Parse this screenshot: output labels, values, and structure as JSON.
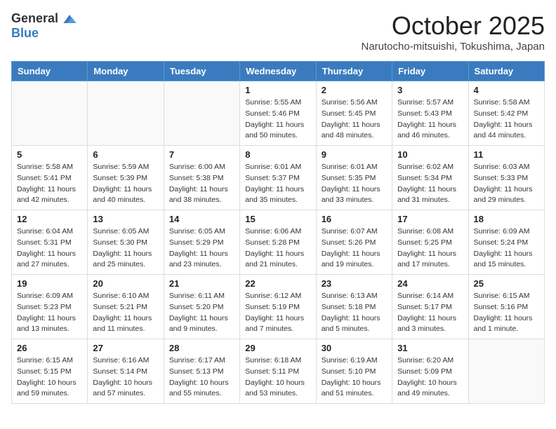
{
  "logo": {
    "general": "General",
    "blue": "Blue"
  },
  "title": "October 2025",
  "location": "Narutocho-mitsuishi, Tokushima, Japan",
  "weekdays": [
    "Sunday",
    "Monday",
    "Tuesday",
    "Wednesday",
    "Thursday",
    "Friday",
    "Saturday"
  ],
  "weeks": [
    [
      {
        "day": "",
        "info": ""
      },
      {
        "day": "",
        "info": ""
      },
      {
        "day": "",
        "info": ""
      },
      {
        "day": "1",
        "info": "Sunrise: 5:55 AM\nSunset: 5:46 PM\nDaylight: 11 hours\nand 50 minutes."
      },
      {
        "day": "2",
        "info": "Sunrise: 5:56 AM\nSunset: 5:45 PM\nDaylight: 11 hours\nand 48 minutes."
      },
      {
        "day": "3",
        "info": "Sunrise: 5:57 AM\nSunset: 5:43 PM\nDaylight: 11 hours\nand 46 minutes."
      },
      {
        "day": "4",
        "info": "Sunrise: 5:58 AM\nSunset: 5:42 PM\nDaylight: 11 hours\nand 44 minutes."
      }
    ],
    [
      {
        "day": "5",
        "info": "Sunrise: 5:58 AM\nSunset: 5:41 PM\nDaylight: 11 hours\nand 42 minutes."
      },
      {
        "day": "6",
        "info": "Sunrise: 5:59 AM\nSunset: 5:39 PM\nDaylight: 11 hours\nand 40 minutes."
      },
      {
        "day": "7",
        "info": "Sunrise: 6:00 AM\nSunset: 5:38 PM\nDaylight: 11 hours\nand 38 minutes."
      },
      {
        "day": "8",
        "info": "Sunrise: 6:01 AM\nSunset: 5:37 PM\nDaylight: 11 hours\nand 35 minutes."
      },
      {
        "day": "9",
        "info": "Sunrise: 6:01 AM\nSunset: 5:35 PM\nDaylight: 11 hours\nand 33 minutes."
      },
      {
        "day": "10",
        "info": "Sunrise: 6:02 AM\nSunset: 5:34 PM\nDaylight: 11 hours\nand 31 minutes."
      },
      {
        "day": "11",
        "info": "Sunrise: 6:03 AM\nSunset: 5:33 PM\nDaylight: 11 hours\nand 29 minutes."
      }
    ],
    [
      {
        "day": "12",
        "info": "Sunrise: 6:04 AM\nSunset: 5:31 PM\nDaylight: 11 hours\nand 27 minutes."
      },
      {
        "day": "13",
        "info": "Sunrise: 6:05 AM\nSunset: 5:30 PM\nDaylight: 11 hours\nand 25 minutes."
      },
      {
        "day": "14",
        "info": "Sunrise: 6:05 AM\nSunset: 5:29 PM\nDaylight: 11 hours\nand 23 minutes."
      },
      {
        "day": "15",
        "info": "Sunrise: 6:06 AM\nSunset: 5:28 PM\nDaylight: 11 hours\nand 21 minutes."
      },
      {
        "day": "16",
        "info": "Sunrise: 6:07 AM\nSunset: 5:26 PM\nDaylight: 11 hours\nand 19 minutes."
      },
      {
        "day": "17",
        "info": "Sunrise: 6:08 AM\nSunset: 5:25 PM\nDaylight: 11 hours\nand 17 minutes."
      },
      {
        "day": "18",
        "info": "Sunrise: 6:09 AM\nSunset: 5:24 PM\nDaylight: 11 hours\nand 15 minutes."
      }
    ],
    [
      {
        "day": "19",
        "info": "Sunrise: 6:09 AM\nSunset: 5:23 PM\nDaylight: 11 hours\nand 13 minutes."
      },
      {
        "day": "20",
        "info": "Sunrise: 6:10 AM\nSunset: 5:21 PM\nDaylight: 11 hours\nand 11 minutes."
      },
      {
        "day": "21",
        "info": "Sunrise: 6:11 AM\nSunset: 5:20 PM\nDaylight: 11 hours\nand 9 minutes."
      },
      {
        "day": "22",
        "info": "Sunrise: 6:12 AM\nSunset: 5:19 PM\nDaylight: 11 hours\nand 7 minutes."
      },
      {
        "day": "23",
        "info": "Sunrise: 6:13 AM\nSunset: 5:18 PM\nDaylight: 11 hours\nand 5 minutes."
      },
      {
        "day": "24",
        "info": "Sunrise: 6:14 AM\nSunset: 5:17 PM\nDaylight: 11 hours\nand 3 minutes."
      },
      {
        "day": "25",
        "info": "Sunrise: 6:15 AM\nSunset: 5:16 PM\nDaylight: 11 hours\nand 1 minute."
      }
    ],
    [
      {
        "day": "26",
        "info": "Sunrise: 6:15 AM\nSunset: 5:15 PM\nDaylight: 10 hours\nand 59 minutes."
      },
      {
        "day": "27",
        "info": "Sunrise: 6:16 AM\nSunset: 5:14 PM\nDaylight: 10 hours\nand 57 minutes."
      },
      {
        "day": "28",
        "info": "Sunrise: 6:17 AM\nSunset: 5:13 PM\nDaylight: 10 hours\nand 55 minutes."
      },
      {
        "day": "29",
        "info": "Sunrise: 6:18 AM\nSunset: 5:11 PM\nDaylight: 10 hours\nand 53 minutes."
      },
      {
        "day": "30",
        "info": "Sunrise: 6:19 AM\nSunset: 5:10 PM\nDaylight: 10 hours\nand 51 minutes."
      },
      {
        "day": "31",
        "info": "Sunrise: 6:20 AM\nSunset: 5:09 PM\nDaylight: 10 hours\nand 49 minutes."
      },
      {
        "day": "",
        "info": ""
      }
    ]
  ]
}
